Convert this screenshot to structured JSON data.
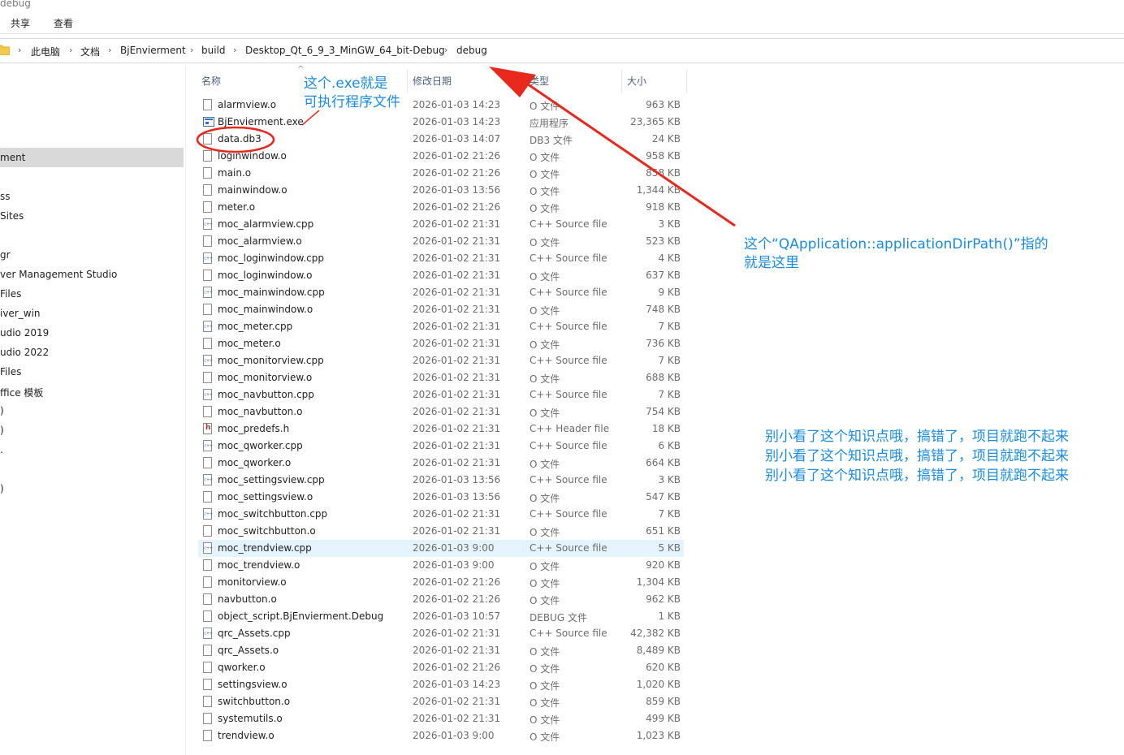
{
  "window": {
    "title": "debug"
  },
  "ribbon": {
    "tabs": [
      "共享",
      "查看"
    ]
  },
  "breadcrumb": [
    "此电脑",
    "文档",
    "BjEnvierment",
    "build",
    "Desktop_Qt_6_9_3_MinGW_64_bit-Debug",
    "debug"
  ],
  "nav_pane": {
    "items": [
      "ment",
      "ss",
      " Sites",
      "gr",
      "ver Management Studio",
      "Files",
      "iver_win",
      "udio 2019",
      "udio 2022",
      "Files",
      "ffice 模板",
      ")",
      ")",
      ".",
      ")"
    ],
    "selected_index": 0
  },
  "columns": {
    "name": "名称",
    "date": "修改日期",
    "type": "类型",
    "size": "大小"
  },
  "files": [
    {
      "name": "alarmview.o",
      "date": "2026-01-03 14:23",
      "type": "O 文件",
      "size": "963 KB",
      "icon": "file"
    },
    {
      "name": "BjEnvierment.exe",
      "date": "2026-01-03 14:23",
      "type": "应用程序",
      "size": "23,365 KB",
      "icon": "exe"
    },
    {
      "name": "data.db3",
      "date": "2026-01-03 14:07",
      "type": "DB3 文件",
      "size": "24 KB",
      "icon": "file"
    },
    {
      "name": "loginwindow.o",
      "date": "2026-01-02 21:26",
      "type": "O 文件",
      "size": "958 KB",
      "icon": "file"
    },
    {
      "name": "main.o",
      "date": "2026-01-02 21:26",
      "type": "O 文件",
      "size": "858 KB",
      "icon": "file"
    },
    {
      "name": "mainwindow.o",
      "date": "2026-01-03 13:56",
      "type": "O 文件",
      "size": "1,344 KB",
      "icon": "file"
    },
    {
      "name": "meter.o",
      "date": "2026-01-02 21:26",
      "type": "O 文件",
      "size": "918 KB",
      "icon": "file"
    },
    {
      "name": "moc_alarmview.cpp",
      "date": "2026-01-02 21:31",
      "type": "C++ Source file",
      "size": "3 KB",
      "icon": "cpp"
    },
    {
      "name": "moc_alarmview.o",
      "date": "2026-01-02 21:31",
      "type": "O 文件",
      "size": "523 KB",
      "icon": "file"
    },
    {
      "name": "moc_loginwindow.cpp",
      "date": "2026-01-02 21:31",
      "type": "C++ Source file",
      "size": "4 KB",
      "icon": "cpp"
    },
    {
      "name": "moc_loginwindow.o",
      "date": "2026-01-02 21:31",
      "type": "O 文件",
      "size": "637 KB",
      "icon": "file"
    },
    {
      "name": "moc_mainwindow.cpp",
      "date": "2026-01-02 21:31",
      "type": "C++ Source file",
      "size": "9 KB",
      "icon": "cpp"
    },
    {
      "name": "moc_mainwindow.o",
      "date": "2026-01-02 21:31",
      "type": "O 文件",
      "size": "748 KB",
      "icon": "file"
    },
    {
      "name": "moc_meter.cpp",
      "date": "2026-01-02 21:31",
      "type": "C++ Source file",
      "size": "7 KB",
      "icon": "cpp"
    },
    {
      "name": "moc_meter.o",
      "date": "2026-01-02 21:31",
      "type": "O 文件",
      "size": "736 KB",
      "icon": "file"
    },
    {
      "name": "moc_monitorview.cpp",
      "date": "2026-01-02 21:31",
      "type": "C++ Source file",
      "size": "7 KB",
      "icon": "cpp"
    },
    {
      "name": "moc_monitorview.o",
      "date": "2026-01-02 21:31",
      "type": "O 文件",
      "size": "688 KB",
      "icon": "file"
    },
    {
      "name": "moc_navbutton.cpp",
      "date": "2026-01-02 21:31",
      "type": "C++ Source file",
      "size": "7 KB",
      "icon": "cpp"
    },
    {
      "name": "moc_navbutton.o",
      "date": "2026-01-02 21:31",
      "type": "O 文件",
      "size": "754 KB",
      "icon": "file"
    },
    {
      "name": "moc_predefs.h",
      "date": "2026-01-02 21:31",
      "type": "C++ Header file",
      "size": "18 KB",
      "icon": "h"
    },
    {
      "name": "moc_qworker.cpp",
      "date": "2026-01-02 21:31",
      "type": "C++ Source file",
      "size": "6 KB",
      "icon": "cpp"
    },
    {
      "name": "moc_qworker.o",
      "date": "2026-01-02 21:31",
      "type": "O 文件",
      "size": "664 KB",
      "icon": "file"
    },
    {
      "name": "moc_settingsview.cpp",
      "date": "2026-01-03 13:56",
      "type": "C++ Source file",
      "size": "3 KB",
      "icon": "cpp"
    },
    {
      "name": "moc_settingsview.o",
      "date": "2026-01-03 13:56",
      "type": "O 文件",
      "size": "547 KB",
      "icon": "file"
    },
    {
      "name": "moc_switchbutton.cpp",
      "date": "2026-01-02 21:31",
      "type": "C++ Source file",
      "size": "7 KB",
      "icon": "cpp"
    },
    {
      "name": "moc_switchbutton.o",
      "date": "2026-01-02 21:31",
      "type": "O 文件",
      "size": "651 KB",
      "icon": "file"
    },
    {
      "name": "moc_trendview.cpp",
      "date": "2026-01-03 9:00",
      "type": "C++ Source file",
      "size": "5 KB",
      "icon": "cpp"
    },
    {
      "name": "moc_trendview.o",
      "date": "2026-01-03 9:00",
      "type": "O 文件",
      "size": "920 KB",
      "icon": "file"
    },
    {
      "name": "monitorview.o",
      "date": "2026-01-02 21:26",
      "type": "O 文件",
      "size": "1,304 KB",
      "icon": "file"
    },
    {
      "name": "navbutton.o",
      "date": "2026-01-02 21:26",
      "type": "O 文件",
      "size": "962 KB",
      "icon": "file"
    },
    {
      "name": "object_script.BjEnvierment.Debug",
      "date": "2026-01-03 10:57",
      "type": "DEBUG 文件",
      "size": "1 KB",
      "icon": "file"
    },
    {
      "name": "qrc_Assets.cpp",
      "date": "2026-01-02 21:31",
      "type": "C++ Source file",
      "size": "42,382 KB",
      "icon": "cpp"
    },
    {
      "name": "qrc_Assets.o",
      "date": "2026-01-02 21:31",
      "type": "O 文件",
      "size": "8,489 KB",
      "icon": "file"
    },
    {
      "name": "qworker.o",
      "date": "2026-01-02 21:26",
      "type": "O 文件",
      "size": "620 KB",
      "icon": "file"
    },
    {
      "name": "settingsview.o",
      "date": "2026-01-03 14:23",
      "type": "O 文件",
      "size": "1,020 KB",
      "icon": "file"
    },
    {
      "name": "switchbutton.o",
      "date": "2026-01-02 21:31",
      "type": "O 文件",
      "size": "859 KB",
      "icon": "file"
    },
    {
      "name": "systemutils.o",
      "date": "2026-01-02 21:31",
      "type": "O 文件",
      "size": "499 KB",
      "icon": "file"
    },
    {
      "name": "trendview.o",
      "date": "2026-01-03 9:00",
      "type": "O 文件",
      "size": "1,023 KB",
      "icon": "file"
    }
  ],
  "highlighted_row": 26,
  "annotations": {
    "exe_note": [
      "这个.exe就是",
      "可执行程序文件"
    ],
    "dirpath_note": [
      "这个“QApplication::applicationDirPath()”指的",
      "就是这里"
    ],
    "warning": [
      "别小看了这个知识点哦，搞错了，项目就跑不起来",
      "别小看了这个知识点哦，搞错了，项目就跑不起来",
      "别小看了这个知识点哦，搞错了，项目就跑不起来"
    ]
  },
  "colors": {
    "annotation_blue": "#1a8ce0",
    "annotation_red": "#e8281c",
    "row_highlight": "#e5f3ff"
  }
}
